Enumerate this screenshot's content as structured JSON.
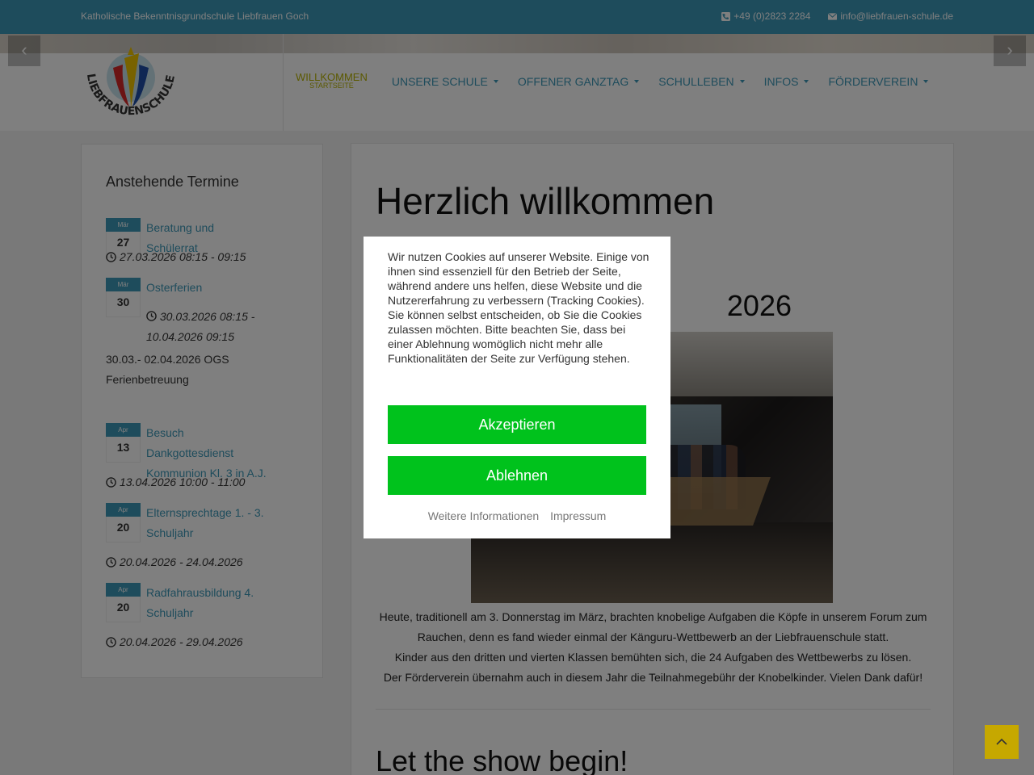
{
  "topbar": {
    "school_name": "Katholische Bekenntnisgrundschule Liebfrauen Goch",
    "phone": "+49 (0)2823 2284",
    "email": "info@liebfrauen-schule.de"
  },
  "logo": {
    "text": "LIEBFRAUENSCHULE GOCH"
  },
  "nav": {
    "active_label": "WILLKOMMEN",
    "active_sublabel": "STARTSEITE",
    "items": [
      {
        "label": "UNSERE SCHULE"
      },
      {
        "label": "OFFENER GANZTAG"
      },
      {
        "label": "SCHULLEBEN"
      },
      {
        "label": "INFOS"
      },
      {
        "label": "FÖRDERVEREIN"
      }
    ]
  },
  "sidebar": {
    "heading": "Anstehende Termine",
    "events": [
      {
        "month": "Mär",
        "day": "27",
        "title": "Beratung und Schülerrat",
        "time": "27.03.2026 08:15 - 09:15",
        "desc": ""
      },
      {
        "month": "Mär",
        "day": "30",
        "title": "Osterferien",
        "time": "30.03.2026 08:15 - 10.04.2026 09:15",
        "desc": "30.03.- 02.04.2026 OGS Ferienbetreuung"
      },
      {
        "month": "Apr",
        "day": "13",
        "title": "Besuch Dankgottesdienst Kommunion Kl. 3 in A.J.",
        "time": "13.04.2026 10:00 - 11:00",
        "desc": ""
      },
      {
        "month": "Apr",
        "day": "20",
        "title": "Elternsprechtage 1. - 3. Schuljahr",
        "time": "20.04.2026 - 24.04.2026",
        "desc": ""
      },
      {
        "month": "Apr",
        "day": "20",
        "title": "Radfahrausbildung 4. Schuljahr",
        "time": "20.04.2026 - 29.04.2026",
        "desc": ""
      }
    ]
  },
  "main": {
    "heading": "Herzlich willkommen",
    "article_title_fragment": "2026",
    "body": [
      "Heute, traditionell am 3. Donnerstag im März, brachten knobelige Aufgaben die Köpfe in unserem Forum zum Rauchen, denn es fand wieder einmal der Känguru-Wettbewerb an der Liebfrauenschule statt.",
      "Kinder aus den dritten und vierten Klassen bemühten sich, die 24 Aufgaben des Wettbewerbs zu lösen.",
      "Der Förderverein übernahm auch in diesem Jahr die Teilnahmegebühr der Knobelkinder. Vielen Dank dafür!"
    ],
    "next_heading": "Let the show begin!"
  },
  "cookie": {
    "text": "Wir nutzen Cookies auf unserer Website. Einige von ihnen sind essenziell für den Betrieb der Seite, während andere uns helfen, diese Website und die Nutzererfahrung zu verbessern (Tracking Cookies). Sie können selbst entscheiden, ob Sie die Cookies zulassen möchten. Bitte beachten Sie, dass bei einer Ablehnung womöglich nicht mehr alle Funktionalitäten der Seite zur Verfügung stehen.",
    "accept_label": "Akzeptieren",
    "decline_label": "Ablehnen",
    "more_info_label": "Weitere Informationen",
    "imprint_label": "Impressum"
  },
  "colors": {
    "brand_blue": "#3d98b8",
    "accept_green": "#00c21c",
    "totop_gold": "#c6a800"
  }
}
